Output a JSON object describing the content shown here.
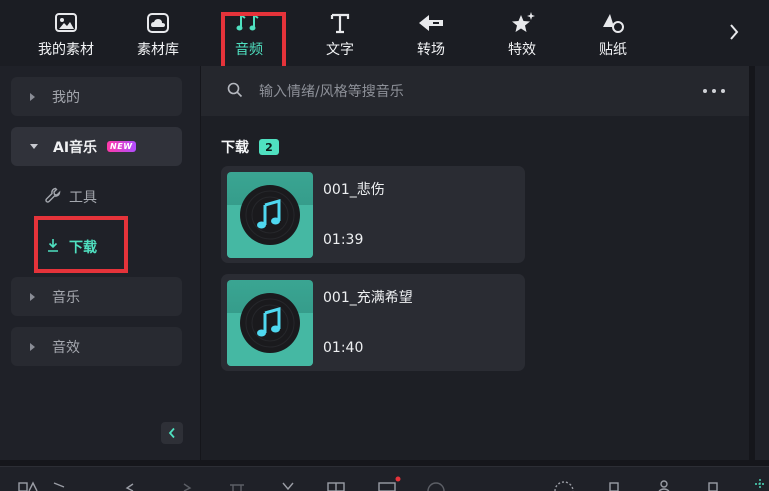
{
  "toolbar": {
    "tabs": [
      {
        "label": "我的素材",
        "icon": "my-media-icon"
      },
      {
        "label": "素材库",
        "icon": "stock-library-icon"
      },
      {
        "label": "音频",
        "icon": "music-notes-icon",
        "active": true
      },
      {
        "label": "文字",
        "icon": "text-t-icon"
      },
      {
        "label": "转场",
        "icon": "transition-icon"
      },
      {
        "label": "特效",
        "icon": "effects-star-icon"
      },
      {
        "label": "贴纸",
        "icon": "sticker-icon"
      }
    ],
    "more_icon": "chevron-right-icon"
  },
  "sidebar": {
    "items": [
      {
        "label": "我的",
        "expanded": false
      },
      {
        "label": "AI音乐",
        "expanded": true,
        "badge": "NEW"
      },
      {
        "label": "音乐",
        "expanded": false
      },
      {
        "label": "音效",
        "expanded": false
      }
    ],
    "subitems": [
      {
        "label": "工具",
        "icon": "wrench-icon"
      },
      {
        "label": "下载",
        "icon": "download-icon",
        "active": true
      }
    ],
    "collapse_icon": "chevron-left-icon"
  },
  "search": {
    "placeholder": "输入情绪/风格等搜音乐"
  },
  "downloads": {
    "title": "下载",
    "count": "2",
    "items": [
      {
        "name": "001_悲伤",
        "duration": "01:39"
      },
      {
        "name": "001_充满希望",
        "duration": "01:40"
      }
    ]
  },
  "colors": {
    "accent": "#4fe0c0",
    "highlight": "#e5333a",
    "new_badge": "#ff3aa8"
  }
}
